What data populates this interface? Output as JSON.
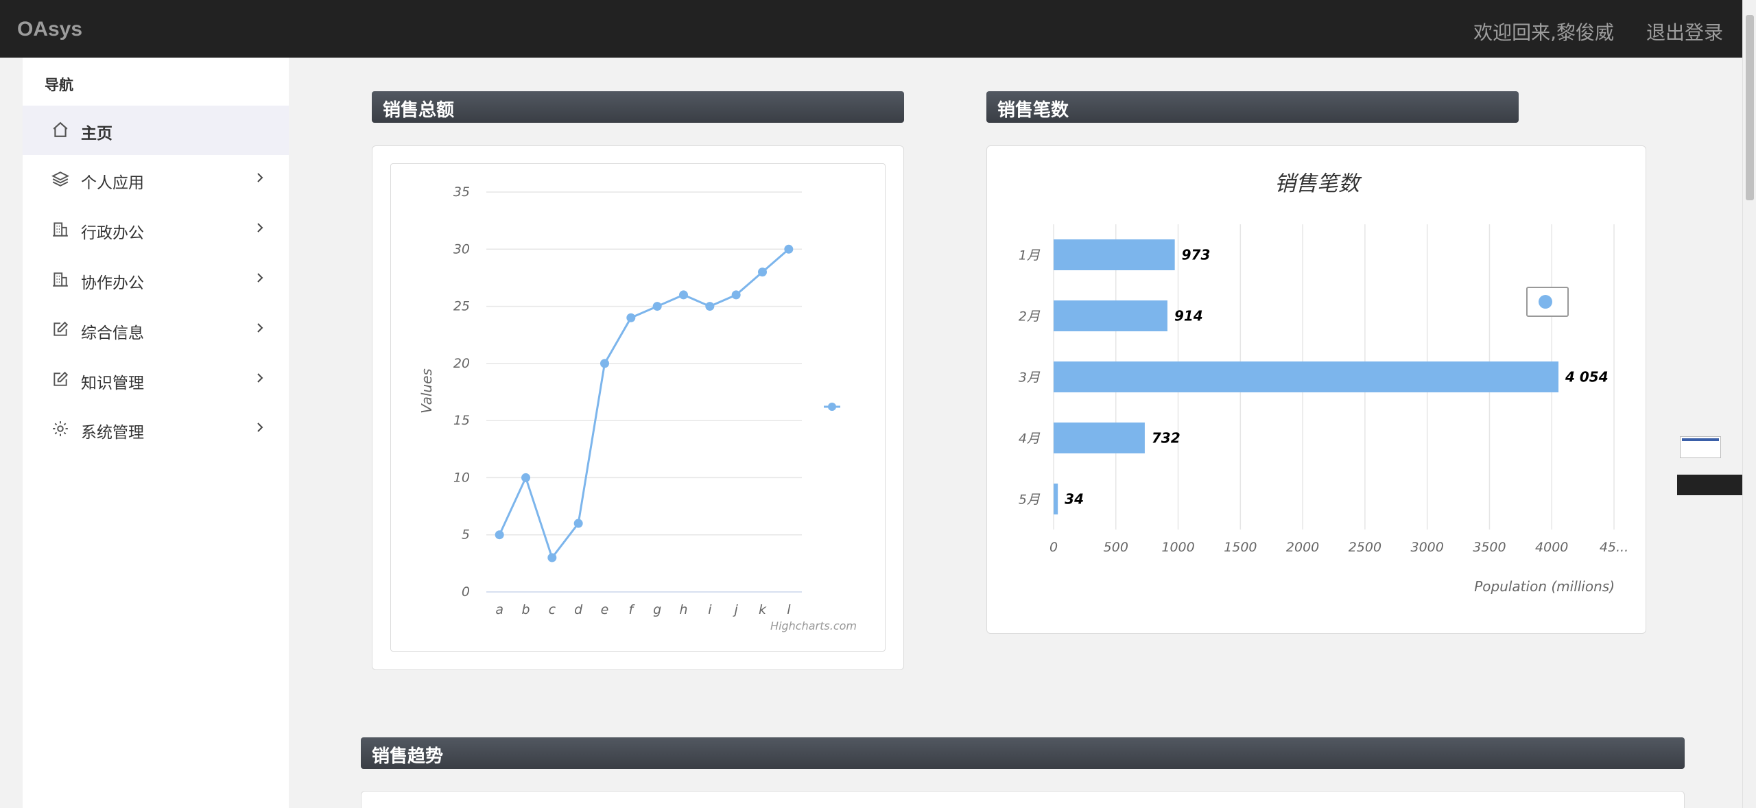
{
  "app": {
    "brand": "OAsys",
    "welcome": "欢迎回来,黎俊威",
    "logout": "退出登录"
  },
  "sidebar": {
    "title": "导航",
    "items": [
      {
        "label": "主页",
        "icon": "home-icon",
        "active": true
      },
      {
        "label": "个人应用",
        "icon": "layers-icon"
      },
      {
        "label": "行政办公",
        "icon": "building-icon"
      },
      {
        "label": "协作办公",
        "icon": "building-icon"
      },
      {
        "label": "综合信息",
        "icon": "edit-icon"
      },
      {
        "label": "知识管理",
        "icon": "edit-icon"
      },
      {
        "label": "系统管理",
        "icon": "gear-icon"
      }
    ]
  },
  "panels": {
    "total_sales": {
      "title": "销售总额"
    },
    "sales_count": {
      "title": "销售笔数"
    },
    "sales_trend": {
      "title": "销售趋势"
    }
  },
  "colors": {
    "series": "#7cb5ec",
    "header_dark": "#3a3e45",
    "topbar": "#222222"
  },
  "chart_data": [
    {
      "type": "line",
      "x": [
        "a",
        "b",
        "c",
        "d",
        "e",
        "f",
        "g",
        "h",
        "i",
        "j",
        "k",
        "l"
      ],
      "series": [
        {
          "values": [
            5,
            10,
            3,
            6,
            20,
            24,
            25,
            26,
            25,
            26,
            28,
            30
          ]
        }
      ],
      "ylabel": "Values",
      "ylim": [
        0,
        35
      ],
      "yticks": [
        "0",
        "5",
        "10",
        "15",
        "20",
        "25",
        "30",
        "35"
      ],
      "credit": "Highcharts.com",
      "grid": true,
      "legend": "right"
    },
    {
      "type": "bar",
      "title": "销售笔数",
      "categories": [
        "1月",
        "2月",
        "3月",
        "4月",
        "5月"
      ],
      "values": [
        973,
        914,
        4054,
        732,
        34
      ],
      "data_labels": [
        "973",
        "914",
        "4 054",
        "732",
        "34"
      ],
      "xlabel": "Population (millions)",
      "xlim": [
        0,
        4500
      ],
      "xticks": [
        "0",
        "500",
        "1000",
        "1500",
        "2000",
        "2500",
        "3000",
        "3500",
        "4000",
        "45..."
      ],
      "grid": true,
      "legend": "top-right"
    }
  ]
}
